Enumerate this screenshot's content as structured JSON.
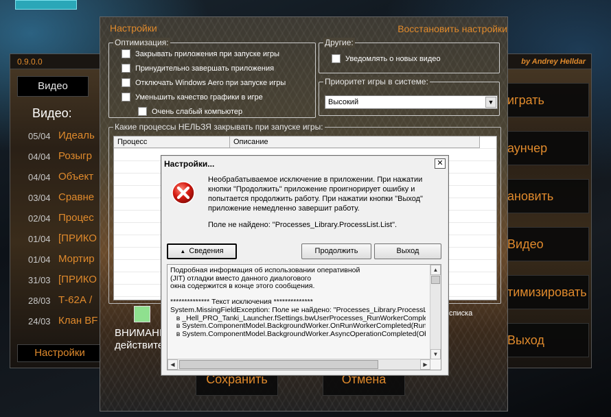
{
  "launcher": {
    "version": "0.9.0.0",
    "author": "by Andrey Helldar",
    "active_tab": "Видео",
    "heading": "Видео:",
    "news": [
      {
        "date": "05/04",
        "title": "Идеаль"
      },
      {
        "date": "04/04",
        "title": "Розыгр"
      },
      {
        "date": "04/04",
        "title": "Объект"
      },
      {
        "date": "03/04",
        "title": "Сравне"
      },
      {
        "date": "02/04",
        "title": "Процес"
      },
      {
        "date": "01/04",
        "title": "[ПРИКО"
      },
      {
        "date": "01/04",
        "title": "Мортир"
      },
      {
        "date": "31/03",
        "title": "[ПРИКО"
      },
      {
        "date": "28/03",
        "title": "Т-62А /"
      },
      {
        "date": "24/03",
        "title": "Клан BF"
      }
    ],
    "settings_button": "Настройки",
    "side_buttons": [
      "играть",
      "аунчер",
      "ановить",
      "Видео",
      "тимизировать",
      "Выход"
    ]
  },
  "settings": {
    "title": "Настройки",
    "restore_link": "Восстановить настройки",
    "optimization": {
      "legend": "Оптимизация:",
      "options": [
        "Закрывать приложения при запуске игры",
        "Принудительно завершать приложения",
        "Отключать Windows Aero при запуске игры",
        "Уменьшить качество графики в игре",
        "Очень слабый компьютер"
      ]
    },
    "other": {
      "legend": "Другие:",
      "options": [
        "Уведомлять о новых видео"
      ]
    },
    "priority": {
      "legend": "Приоритет игры в системе:",
      "value": "Высокий"
    },
    "processes": {
      "legend": "Какие процессы НЕЛЬЗЯ закрывать при запуске игры:",
      "columns": [
        "Процесс",
        "Описание"
      ]
    },
    "warning": "ВНИМАНИЕ!",
    "warning_line2": "действите",
    "list_note": "списка",
    "save_button": "Сохранить",
    "cancel_button": "Отмена"
  },
  "dialog": {
    "title": "Настройки...",
    "close_glyph": "✕",
    "message": "Необрабатываемое исключение в приложении. При нажатии кнопки \"Продолжить\" приложение проигнорирует ошибку и попытается продолжить работу. При нажатии кнопки \"Выход\" приложение немедленно завершит работу.",
    "field_error": "Поле не найдено: \"Processes_Library.ProcessList.List\".",
    "details_button": "Сведения",
    "continue_button": "Продолжить",
    "exit_button": "Выход",
    "details_text": "Подробная информация об использовании оперативной\n(JIT) отладки вместо данного диалогового\nокна содержится в конце этого сообщения.\n\n************** Текст исключения **************\nSystem.MissingFieldException: Поле не найдено: \"Processes_Library.ProcessList.List\".\n   в _Hell_PRO_Tanki_Launcher.fSettings.bwUserProcesses_RunWorkerCompleted(Object sender, RunWorkerCompletedEventArgs e)\n   в System.ComponentModel.BackgroundWorker.OnRunWorkerCompleted(RunWorkerCompletedEventArgs e)\n   в System.ComponentModel.BackgroundWorker.AsyncOperationCompleted(Object arg)"
  }
}
